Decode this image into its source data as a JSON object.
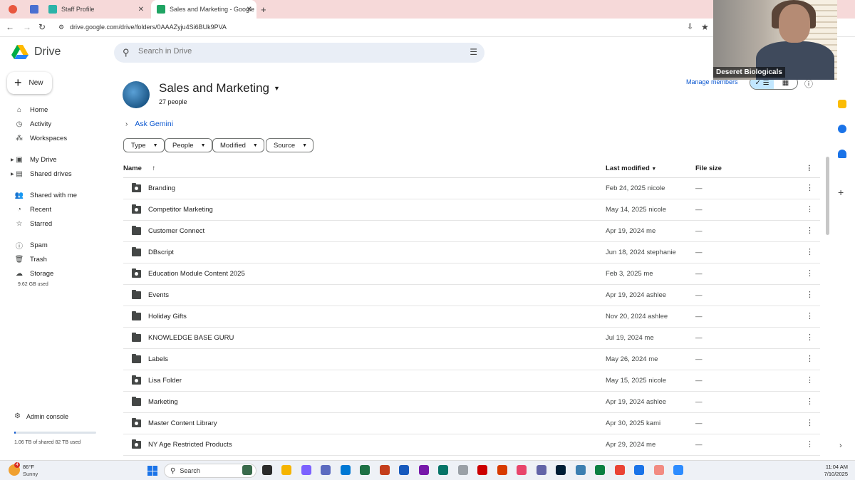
{
  "browser": {
    "tabs": [
      {
        "label": "",
        "favicon_color": "#e8563e"
      },
      {
        "label": "",
        "favicon_color": "#4a6fd1"
      },
      {
        "label": "Staff Profile",
        "favicon_color": "#2bb3a8"
      },
      {
        "label": "Sales and Marketing - Google",
        "favicon_color": "#1fa463"
      }
    ],
    "url": "drive.google.com/drive/folders/0AAAZyju4Si6BUk9PVA"
  },
  "header": {
    "app_name": "Drive",
    "search_placeholder": "Search in Drive"
  },
  "sidebar": {
    "new_label": "New",
    "items": [
      {
        "label": "Home",
        "icon": "home-icon"
      },
      {
        "label": "Activity",
        "icon": "activity-icon"
      },
      {
        "label": "Workspaces",
        "icon": "workspaces-icon"
      },
      {
        "label": "My Drive",
        "icon": "my-drive-icon"
      },
      {
        "label": "Shared drives",
        "icon": "shared-drives-icon"
      },
      {
        "label": "Shared with me",
        "icon": "shared-with-me-icon"
      },
      {
        "label": "Recent",
        "icon": "clock-icon"
      },
      {
        "label": "Starred",
        "icon": "star-icon"
      },
      {
        "label": "Spam",
        "icon": "spam-icon"
      },
      {
        "label": "Trash",
        "icon": "trash-icon"
      },
      {
        "label": "Storage",
        "icon": "cloud-icon"
      }
    ],
    "storage_used": "9.62 GB used",
    "admin_console": "Admin console",
    "shared_storage": "1.06 TB of shared 82 TB used",
    "shared_storage_fraction": 0.013
  },
  "drive": {
    "title": "Sales and Marketing",
    "people": "27 people",
    "manage_members": "Manage members",
    "ask_gemini": "Ask Gemini",
    "filters": [
      "Type",
      "People",
      "Modified",
      "Source"
    ],
    "columns": {
      "name": "Name",
      "last_modified": "Last modified",
      "file_size": "File size"
    },
    "rows": [
      {
        "name": "Branding",
        "modified": "Feb 24, 2025 nicole",
        "size": "—",
        "shared": true
      },
      {
        "name": "Competitor Marketing",
        "modified": "May 14, 2025 nicole",
        "size": "—",
        "shared": true
      },
      {
        "name": "Customer Connect",
        "modified": "Apr 19, 2024 me",
        "size": "—",
        "shared": false
      },
      {
        "name": "DBscript",
        "modified": "Jun 18, 2024 stephanie",
        "size": "—",
        "shared": false
      },
      {
        "name": "Education Module Content 2025",
        "modified": "Feb 3, 2025 me",
        "size": "—",
        "shared": true
      },
      {
        "name": "Events",
        "modified": "Apr 19, 2024 ashlee",
        "size": "—",
        "shared": false
      },
      {
        "name": "Holiday Gifts",
        "modified": "Nov 20, 2024 ashlee",
        "size": "—",
        "shared": false
      },
      {
        "name": "KNOWLEDGE BASE GURU",
        "modified": "Jul 19, 2024 me",
        "size": "—",
        "shared": false
      },
      {
        "name": "Labels",
        "modified": "May 26, 2024 me",
        "size": "—",
        "shared": false
      },
      {
        "name": "Lisa Folder",
        "modified": "May 15, 2025 nicole",
        "size": "—",
        "shared": true
      },
      {
        "name": "Marketing",
        "modified": "Apr 19, 2024 ashlee",
        "size": "—",
        "shared": false
      },
      {
        "name": "Master Content Library",
        "modified": "Apr 30, 2025 kami",
        "size": "—",
        "shared": true
      },
      {
        "name": "NY Age Restricted Products",
        "modified": "Apr 29, 2024 me",
        "size": "—",
        "shared": true
      }
    ]
  },
  "webcam": {
    "label": "Deseret Biologicals"
  },
  "taskbar": {
    "badge": "4",
    "temp": "86°F",
    "condition": "Sunny",
    "search_label": "Search",
    "time": "11:04 AM",
    "date": "7/10/2025",
    "app_colors": [
      "#3a6b4c",
      "#2b2b2b",
      "#f5b400",
      "#7b61ff",
      "#5c6bc0",
      "#0078d4",
      "#1e7145",
      "#c43e1c",
      "#185abd",
      "#7719aa",
      "#077568",
      "#9aa0a6",
      "#cc0000",
      "#d83b01",
      "#e8456b",
      "#6264a7",
      "#001e36",
      "#3c7fb1",
      "#0b8043",
      "#ea4335",
      "#1a73e8",
      "#f28b82",
      "#2d8cff"
    ]
  },
  "colors": {
    "accent": "#0b57d0",
    "selected_toggle": "#c2e7ff"
  }
}
